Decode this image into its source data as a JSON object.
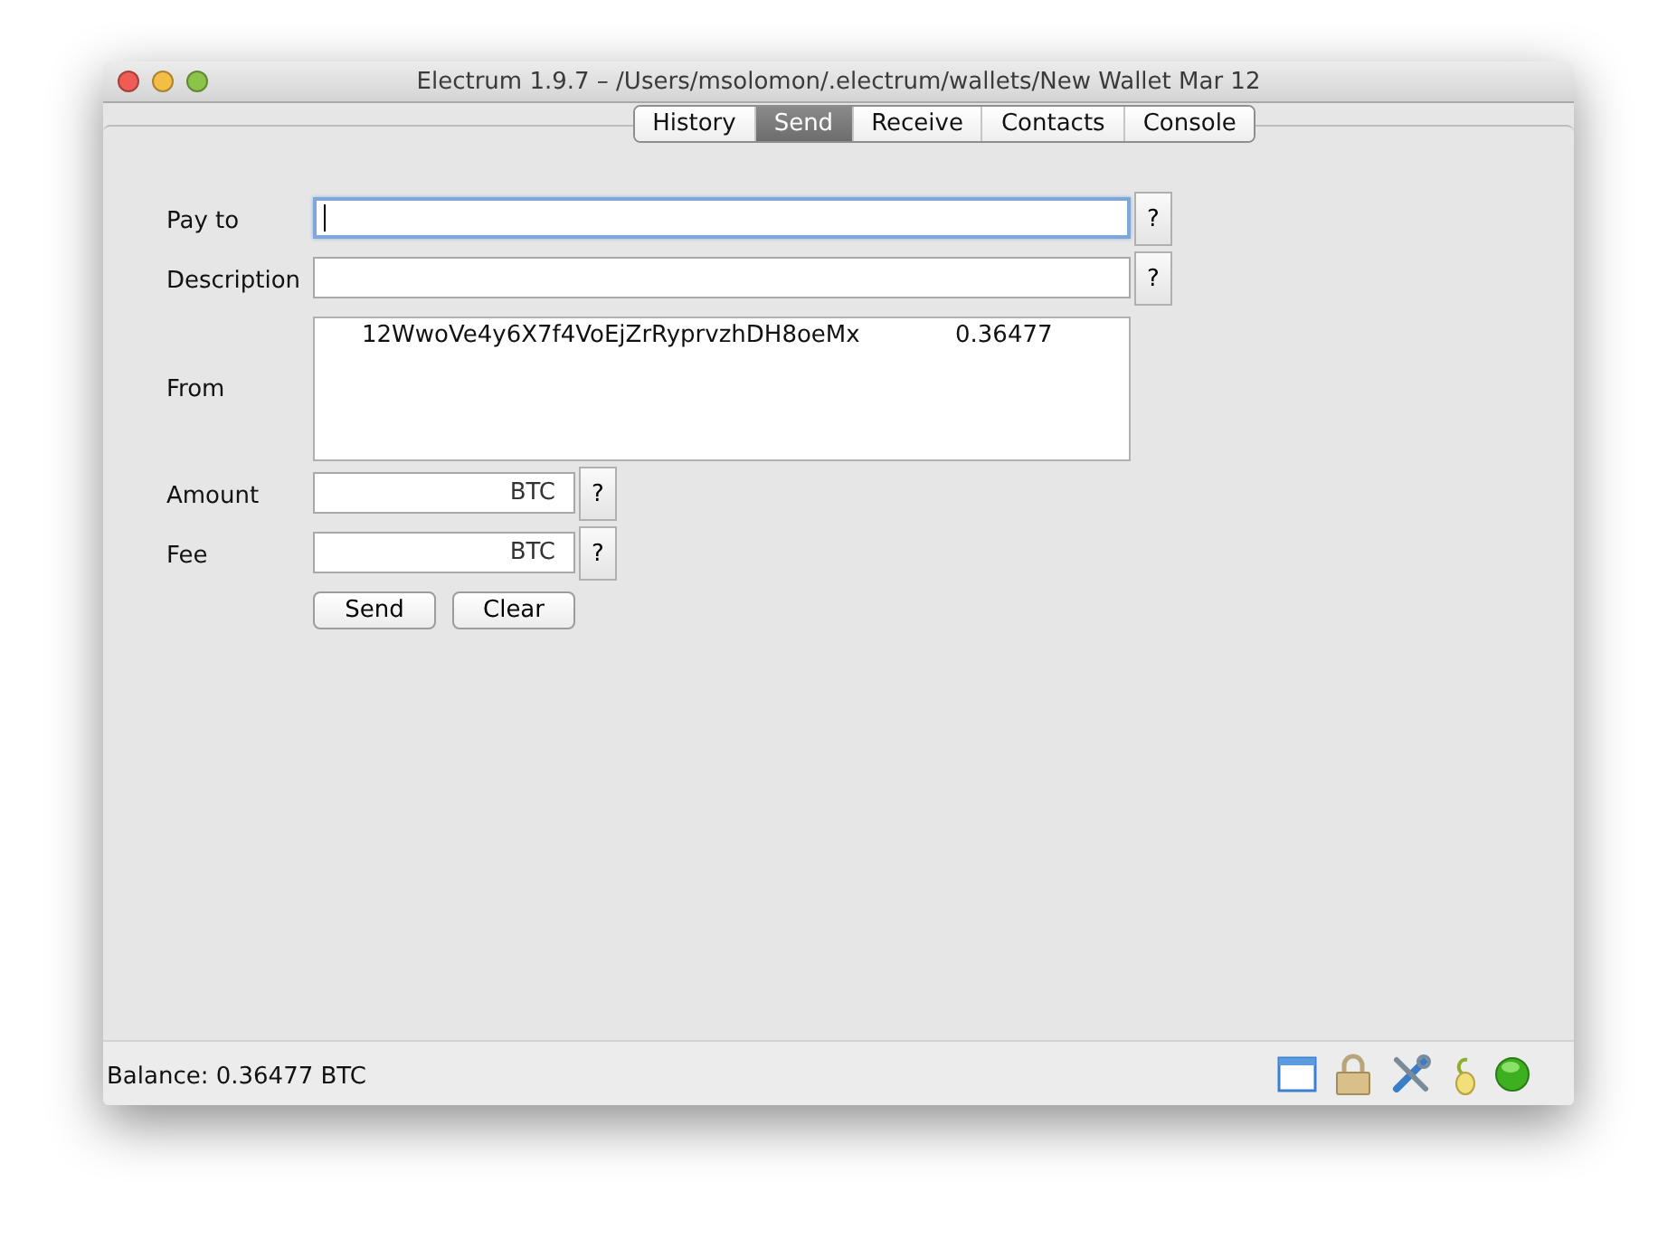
{
  "window": {
    "title": "Electrum 1.9.7  –  /Users/msolomon/.electrum/wallets/New Wallet Mar 12"
  },
  "tabs": [
    {
      "label": "History",
      "selected": false
    },
    {
      "label": "Send",
      "selected": true
    },
    {
      "label": "Receive",
      "selected": false
    },
    {
      "label": "Contacts",
      "selected": false
    },
    {
      "label": "Console",
      "selected": false
    }
  ],
  "form": {
    "pay_to": {
      "label": "Pay to",
      "help": "?",
      "focused": true
    },
    "description": {
      "label": "Description",
      "help": "?",
      "focused": false
    },
    "from": {
      "label": "From",
      "rows": [
        {
          "address": "12WwoVe4y6X7f4VoEjZrRyprvzhDH8oeMx",
          "amount": "0.36477"
        }
      ]
    },
    "amount": {
      "label": "Amount",
      "unit": "BTC",
      "help": "?"
    },
    "fee": {
      "label": "Fee",
      "unit": "BTC",
      "help": "?"
    },
    "buttons": [
      "Send",
      "Clear"
    ]
  },
  "status_bar": {
    "balance": "Balance: 0.36477 BTC"
  }
}
